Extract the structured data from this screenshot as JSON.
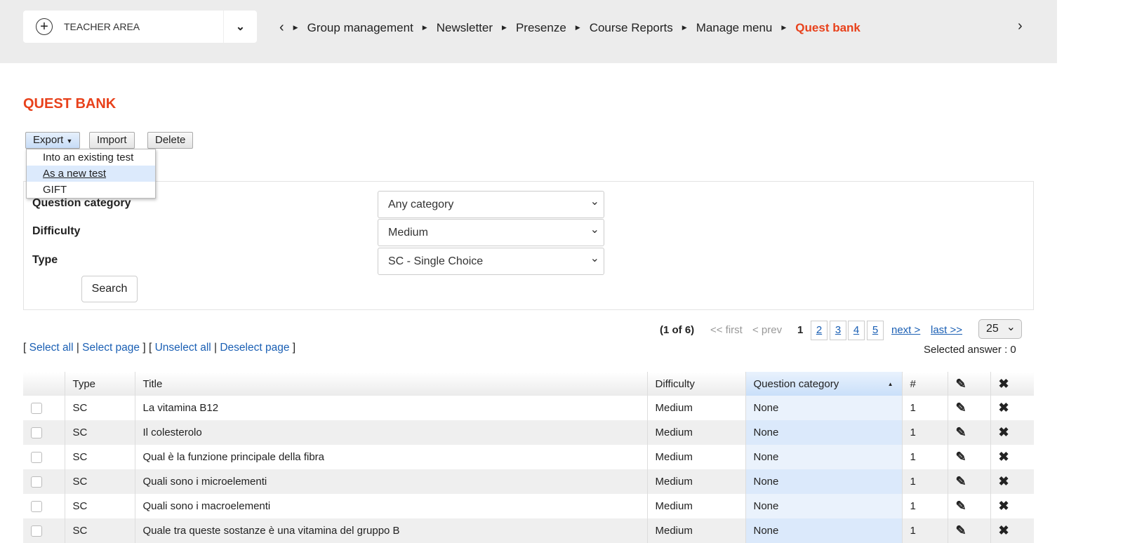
{
  "header": {
    "area_label": "TEACHER AREA",
    "breadcrumbs": [
      "Group management",
      "Newsletter",
      "Presenze",
      "Course Reports",
      "Manage menu"
    ],
    "current": "Quest bank"
  },
  "page_title": "QUEST BANK",
  "toolbar": {
    "export": "Export",
    "import": "Import",
    "delete": "Delete"
  },
  "export_menu": [
    "Into an existing test",
    "As a new test",
    "GIFT"
  ],
  "filters": {
    "category_label": "Question category",
    "category_value": "Any category",
    "difficulty_label": "Difficulty",
    "difficulty_value": "Medium",
    "type_label": "Type",
    "type_value": "SC - Single Choice",
    "search": "Search"
  },
  "pager": {
    "summary": "(1 of 6)",
    "first": "<< first",
    "prev": "< prev",
    "current": "1",
    "pages": [
      "2",
      "3",
      "4",
      "5"
    ],
    "next": "next >",
    "last": "last >>",
    "per_page": "25"
  },
  "selection": {
    "select_all": "Select all",
    "select_page": "Select page",
    "unselect_all": "Unselect all",
    "deselect_page": "Deselect page",
    "selected_answer": "Selected answer : 0"
  },
  "table": {
    "headers": {
      "type": "Type",
      "title": "Title",
      "difficulty": "Difficulty",
      "category": "Question category",
      "count": "#"
    },
    "rows": [
      {
        "type": "SC",
        "title": "La vitamina B12",
        "difficulty": "Medium",
        "category": "None",
        "count": "1"
      },
      {
        "type": "SC",
        "title": "Il colesterolo",
        "difficulty": "Medium",
        "category": "None",
        "count": "1"
      },
      {
        "type": "SC",
        "title": "Qual è la funzione principale della fibra",
        "difficulty": "Medium",
        "category": "None",
        "count": "1"
      },
      {
        "type": "SC",
        "title": "Quali sono i microelementi",
        "difficulty": "Medium",
        "category": "None",
        "count": "1"
      },
      {
        "type": "SC",
        "title": "Quali sono i macroelementi",
        "difficulty": "Medium",
        "category": "None",
        "count": "1"
      },
      {
        "type": "SC",
        "title": "Quale tra queste sostanze è una  vitamina del gruppo B",
        "difficulty": "Medium",
        "category": "None",
        "count": "1"
      }
    ]
  }
}
